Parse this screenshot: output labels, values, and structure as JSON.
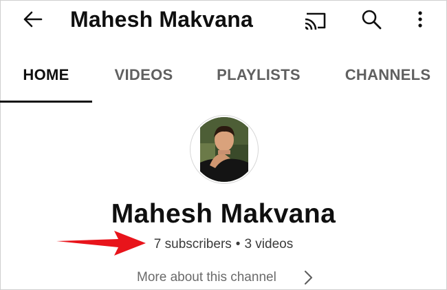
{
  "header": {
    "title": "Mahesh Makvana",
    "icons": [
      "back-arrow-icon",
      "cast-icon",
      "search-icon",
      "more-vertical-icon"
    ]
  },
  "tabs": [
    {
      "label": "HOME",
      "active": true
    },
    {
      "label": "VIDEOS",
      "active": false
    },
    {
      "label": "PLAYLISTS",
      "active": false
    },
    {
      "label": "CHANNELS",
      "active": false
    }
  ],
  "channel": {
    "name": "Mahesh Makvana",
    "subscribers": "7 subscribers",
    "separator": "•",
    "videos": "3 videos",
    "more_about": "More about this channel"
  },
  "colors": {
    "annotation_arrow": "#e8141b",
    "text_primary": "#0f0f0f",
    "text_secondary": "#606060"
  }
}
